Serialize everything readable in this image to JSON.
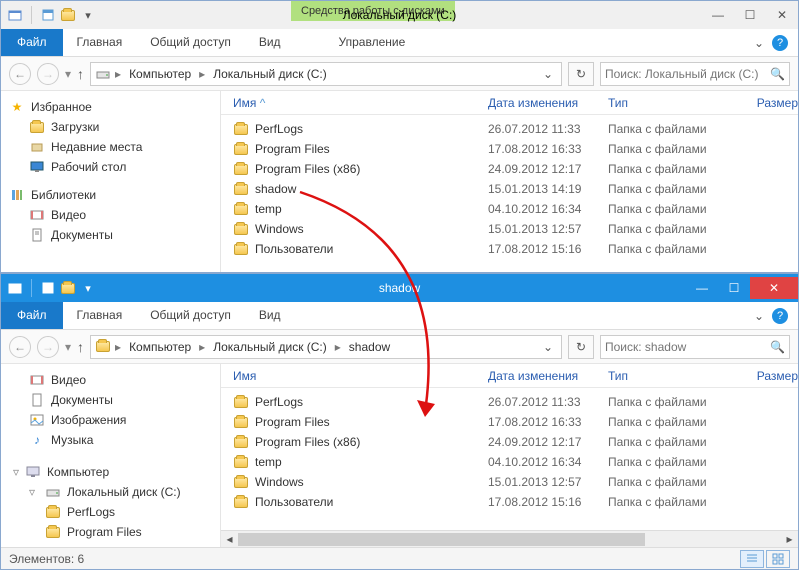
{
  "top": {
    "tools_tab": "Средства работы с дисками",
    "title": "Локальный диск (C:)",
    "tabs": {
      "file": "Файл",
      "home": "Главная",
      "share": "Общий доступ",
      "view": "Вид",
      "manage": "Управление"
    },
    "breadcrumb": {
      "computer": "Компьютер",
      "drive": "Локальный диск (C:)"
    },
    "search_placeholder": "Поиск: Локальный диск (C:)",
    "columns": {
      "name": "Имя",
      "date": "Дата изменения",
      "type": "Тип",
      "size": "Размер"
    },
    "sidebar": {
      "favorites": {
        "head": "Избранное",
        "downloads": "Загрузки",
        "recent": "Недавние места",
        "desktop": "Рабочий стол"
      },
      "libraries": {
        "head": "Библиотеки",
        "videos": "Видео",
        "documents": "Документы"
      }
    },
    "files": [
      {
        "name": "PerfLogs",
        "date": "26.07.2012 11:33",
        "type": "Папка с файлами"
      },
      {
        "name": "Program Files",
        "date": "17.08.2012 16:33",
        "type": "Папка с файлами"
      },
      {
        "name": "Program Files (x86)",
        "date": "24.09.2012 12:17",
        "type": "Папка с файлами"
      },
      {
        "name": "shadow",
        "date": "15.01.2013 14:19",
        "type": "Папка с файлами"
      },
      {
        "name": "temp",
        "date": "04.10.2012 16:34",
        "type": "Папка с файлами"
      },
      {
        "name": "Windows",
        "date": "15.01.2013 12:57",
        "type": "Папка с файлами"
      },
      {
        "name": "Пользователи",
        "date": "17.08.2012 15:16",
        "type": "Папка с файлами"
      }
    ]
  },
  "bottom": {
    "title": "shadow",
    "tabs": {
      "file": "Файл",
      "home": "Главная",
      "share": "Общий доступ",
      "view": "Вид"
    },
    "breadcrumb": {
      "computer": "Компьютер",
      "drive": "Локальный диск (C:)",
      "folder": "shadow"
    },
    "search_placeholder": "Поиск: shadow",
    "columns": {
      "name": "Имя",
      "date": "Дата изменения",
      "type": "Тип",
      "size": "Размер"
    },
    "sidebar": {
      "videos": "Видео",
      "documents": "Документы",
      "pictures": "Изображения",
      "music": "Музыка",
      "computer": "Компьютер",
      "drive": "Локальный диск (C:)",
      "perflogs": "PerfLogs",
      "programfiles": "Program Files"
    },
    "files": [
      {
        "name": "PerfLogs",
        "date": "26.07.2012 11:33",
        "type": "Папка с файлами"
      },
      {
        "name": "Program Files",
        "date": "17.08.2012 16:33",
        "type": "Папка с файлами"
      },
      {
        "name": "Program Files (x86)",
        "date": "24.09.2012 12:17",
        "type": "Папка с файлами"
      },
      {
        "name": "temp",
        "date": "04.10.2012 16:34",
        "type": "Папка с файлами"
      },
      {
        "name": "Windows",
        "date": "15.01.2013 12:57",
        "type": "Папка с файлами"
      },
      {
        "name": "Пользователи",
        "date": "17.08.2012 15:16",
        "type": "Папка с файлами"
      }
    ],
    "status": "Элементов: 6"
  }
}
